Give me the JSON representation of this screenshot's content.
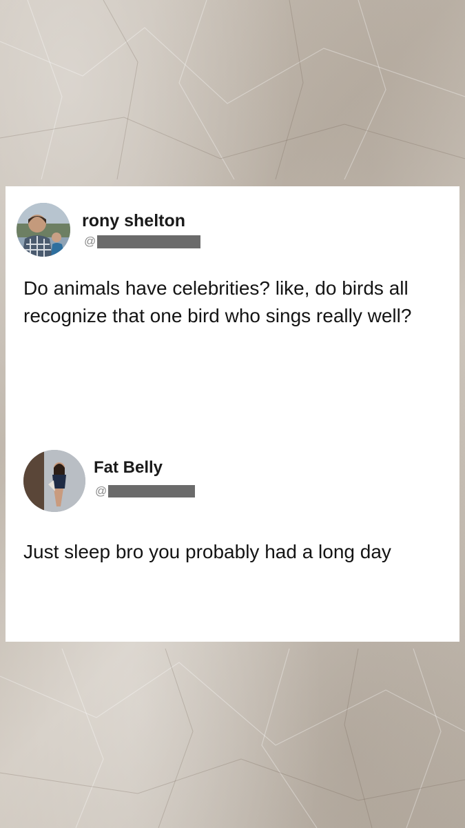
{
  "background": {
    "style": "crumpled-paper",
    "color": "#c7bfb4"
  },
  "post": {
    "author": {
      "display_name": "rony shelton",
      "handle_prefix": "@",
      "handle_redacted": true,
      "avatar": "profile-photo-icon"
    },
    "text": "Do animals have celebrities? like, do birds all recognize that one bird who sings really well?"
  },
  "reply": {
    "author": {
      "display_name": "Fat Belly",
      "handle_prefix": "@",
      "handle_redacted": true,
      "avatar": "profile-photo-icon"
    },
    "text": "Just sleep bro you probably had a long day"
  },
  "colors": {
    "card": "#ffffff",
    "text": "#141414",
    "handle": "#8a8a8a",
    "redaction": "#6b6b6b"
  }
}
